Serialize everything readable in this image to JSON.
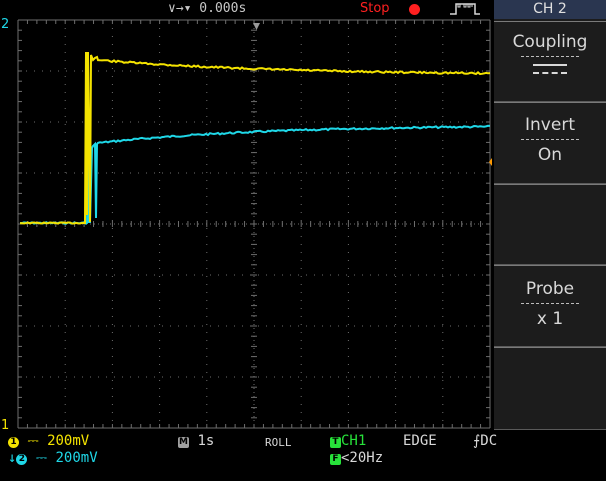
{
  "top_bar": {
    "trigger_position": "∨→▾ 0.000s",
    "run_state": "Stop",
    "acquire_icon": "pulse-waveform-icon"
  },
  "menu": {
    "header": "CH 2",
    "items": [
      {
        "label": "Coupling",
        "value_icon": "dc-coupling-icon"
      },
      {
        "label": "Invert",
        "value": "On"
      },
      {
        "label": "",
        "value": ""
      },
      {
        "label": "Probe",
        "value": "x 1"
      },
      {
        "label": "",
        "value": ""
      }
    ]
  },
  "markers": {
    "ch2_ground": "2",
    "ch1_ground": "1"
  },
  "status": {
    "ch1_scale": "200mV",
    "ch2_scale": "200mV",
    "timebase": "1s",
    "mode": "ROLL",
    "trigger_source": "CH1",
    "trigger_type": "EDGE",
    "trigger_coupling": "DC",
    "trigger_filter": "<20Hz"
  },
  "colors": {
    "ch1": "#f4e300",
    "ch2": "#1fd8e8",
    "trigger": "#27e23a",
    "stop": "#ff2020",
    "grid": "#6e6e6e",
    "background": "#000000"
  }
}
